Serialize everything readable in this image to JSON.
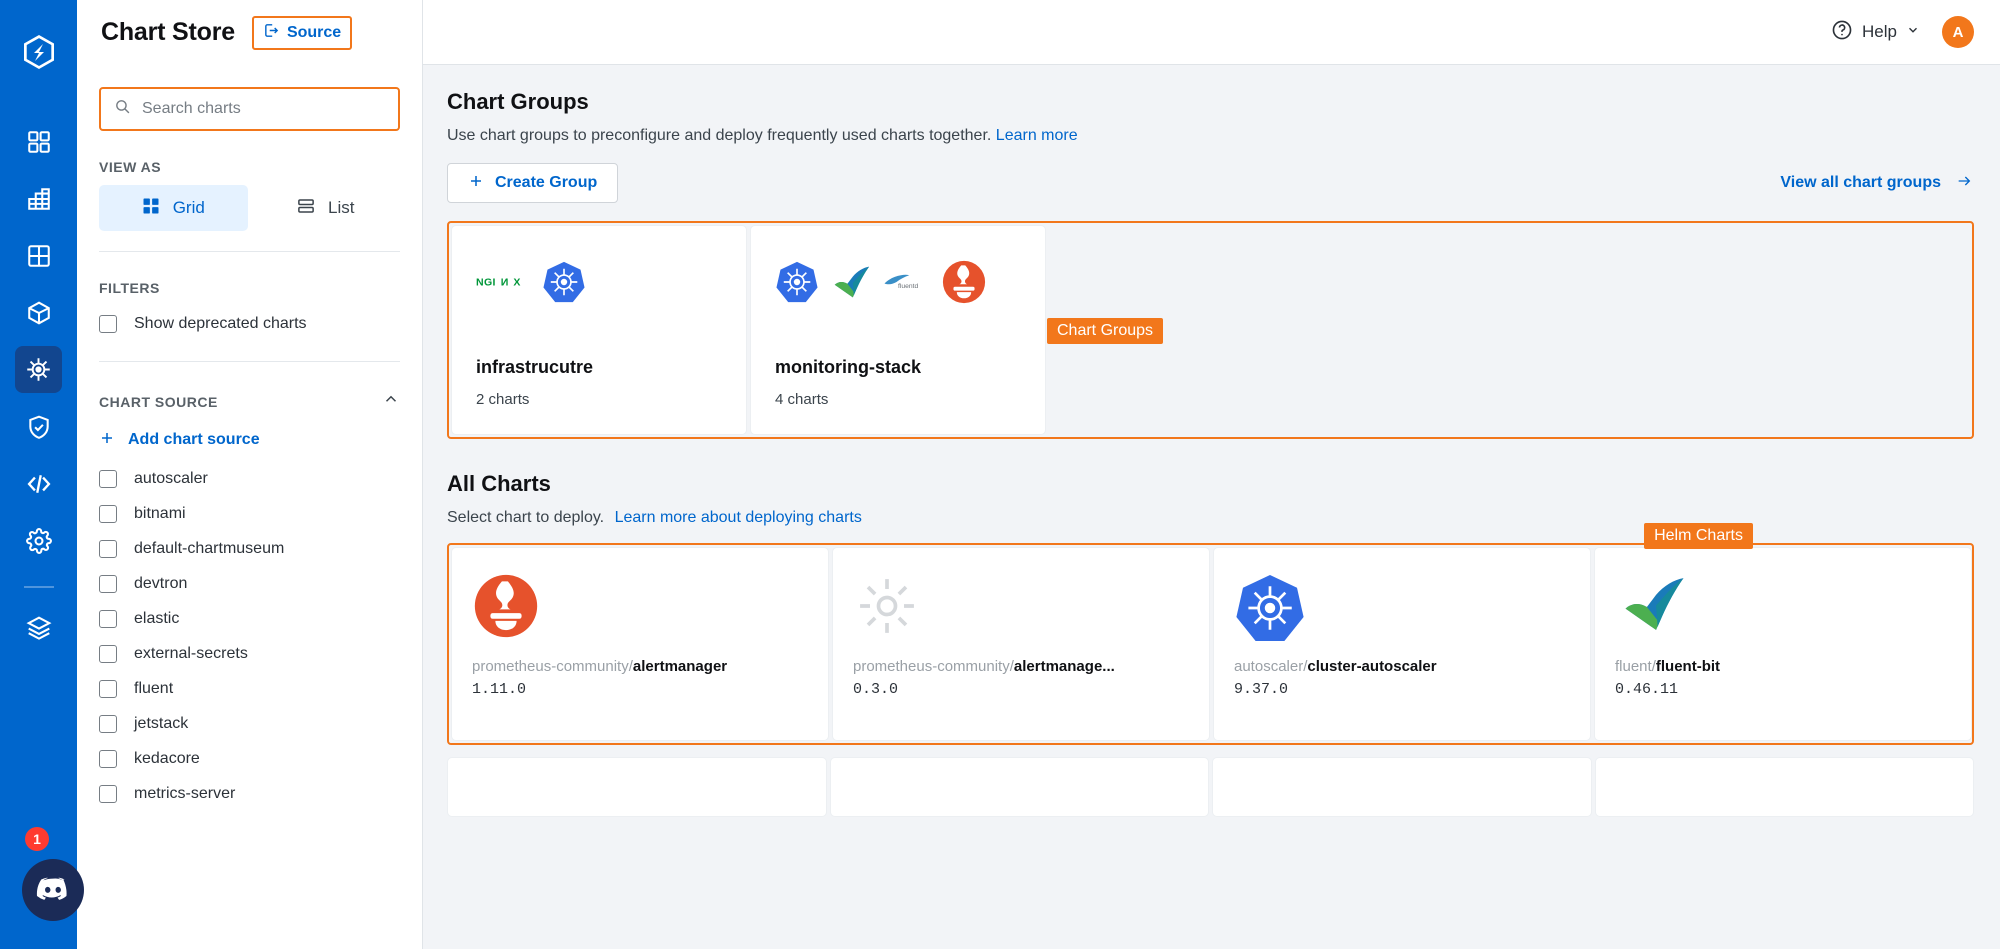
{
  "header": {
    "title": "Chart Store",
    "source_label": "Source",
    "source_icon": "login-arrow-icon",
    "help_label": "Help",
    "avatar_initial": "A"
  },
  "rail": {
    "logo_icon": "devtron-logo-icon",
    "badge_count": "1",
    "items": [
      {
        "name": "applications",
        "icon": "grid-squares-icon",
        "active": false
      },
      {
        "name": "jobs",
        "icon": "table-chart-icon",
        "active": false
      },
      {
        "name": "resource-browser",
        "icon": "four-pane-grid-icon",
        "active": false
      },
      {
        "name": "software-distribution",
        "icon": "cube-icon",
        "active": false
      },
      {
        "name": "chart-store",
        "icon": "helm-wheel-icon",
        "active": true
      },
      {
        "name": "security",
        "icon": "shield-check-icon",
        "active": false
      },
      {
        "name": "bulk-edit",
        "icon": "code-brackets-icon",
        "active": false
      },
      {
        "name": "global-configurations",
        "icon": "gear-icon",
        "active": false
      },
      {
        "name": "stack-manager",
        "icon": "layers-icon",
        "active": false
      }
    ],
    "discord_icon": "discord-icon"
  },
  "sidebar": {
    "search": {
      "placeholder": "Search charts",
      "value": "",
      "icon": "search-icon"
    },
    "view_as_label": "VIEW AS",
    "view_options": [
      {
        "label": "Grid",
        "icon": "grid-view-icon",
        "active": true
      },
      {
        "label": "List",
        "icon": "list-view-icon",
        "active": false
      }
    ],
    "filters_label": "FILTERS",
    "filters": [
      {
        "label": "Show deprecated charts",
        "checked": false
      }
    ],
    "chart_source_label": "CHART SOURCE",
    "collapse_icon": "chevron-up-icon",
    "add_chart_source_label": "Add chart source",
    "add_icon": "plus-icon",
    "sources": [
      {
        "label": "autoscaler",
        "checked": false
      },
      {
        "label": "bitnami",
        "checked": false
      },
      {
        "label": "default-chartmuseum",
        "checked": false
      },
      {
        "label": "devtron",
        "checked": false
      },
      {
        "label": "elastic",
        "checked": false
      },
      {
        "label": "external-secrets",
        "checked": false
      },
      {
        "label": "fluent",
        "checked": false
      },
      {
        "label": "jetstack",
        "checked": false
      },
      {
        "label": "kedacore",
        "checked": false
      },
      {
        "label": "metrics-server",
        "checked": false
      }
    ]
  },
  "chart_groups": {
    "title": "Chart Groups",
    "subtitle": "Use chart groups to preconfigure and deploy frequently used charts together.",
    "learn_more": "Learn more",
    "create_button": "Create Group",
    "create_icon": "plus-icon",
    "view_all": "View all chart groups",
    "view_all_icon": "arrow-right-icon",
    "annotation_tag": "Chart Groups",
    "cards": [
      {
        "name": "infrastrucutre",
        "count": "2 charts",
        "logos": [
          "nginx-logo",
          "kubernetes-logo"
        ]
      },
      {
        "name": "monitoring-stack",
        "count": "4 charts",
        "logos": [
          "kubernetes-logo",
          "fluent-bit-logo",
          "fluentd-logo",
          "prometheus-logo"
        ]
      }
    ]
  },
  "all_charts": {
    "title": "All Charts",
    "subtitle": "Select chart to deploy.",
    "learn_more": "Learn more about deploying charts",
    "annotation_tag": "Helm Charts",
    "cards": [
      {
        "repo": "prometheus-community/",
        "chart": "alertmanager",
        "version": "1.11.0",
        "logo": "prometheus-logo"
      },
      {
        "repo": "prometheus-community/",
        "chart": "alertmanage...",
        "version": "0.3.0",
        "logo": "gear-gray-logo"
      },
      {
        "repo": "autoscaler/",
        "chart": "cluster-autoscaler",
        "version": "9.37.0",
        "logo": "kubernetes-logo"
      },
      {
        "repo": "fluent/",
        "chart": "fluent-bit",
        "version": "0.46.11",
        "logo": "fluent-bit-logo"
      }
    ]
  },
  "colors": {
    "brand_blue": "#0066cc",
    "rail_blue": "#0066cc",
    "accent_orange": "#f2771b",
    "bg_gray": "#f2f4f7"
  }
}
